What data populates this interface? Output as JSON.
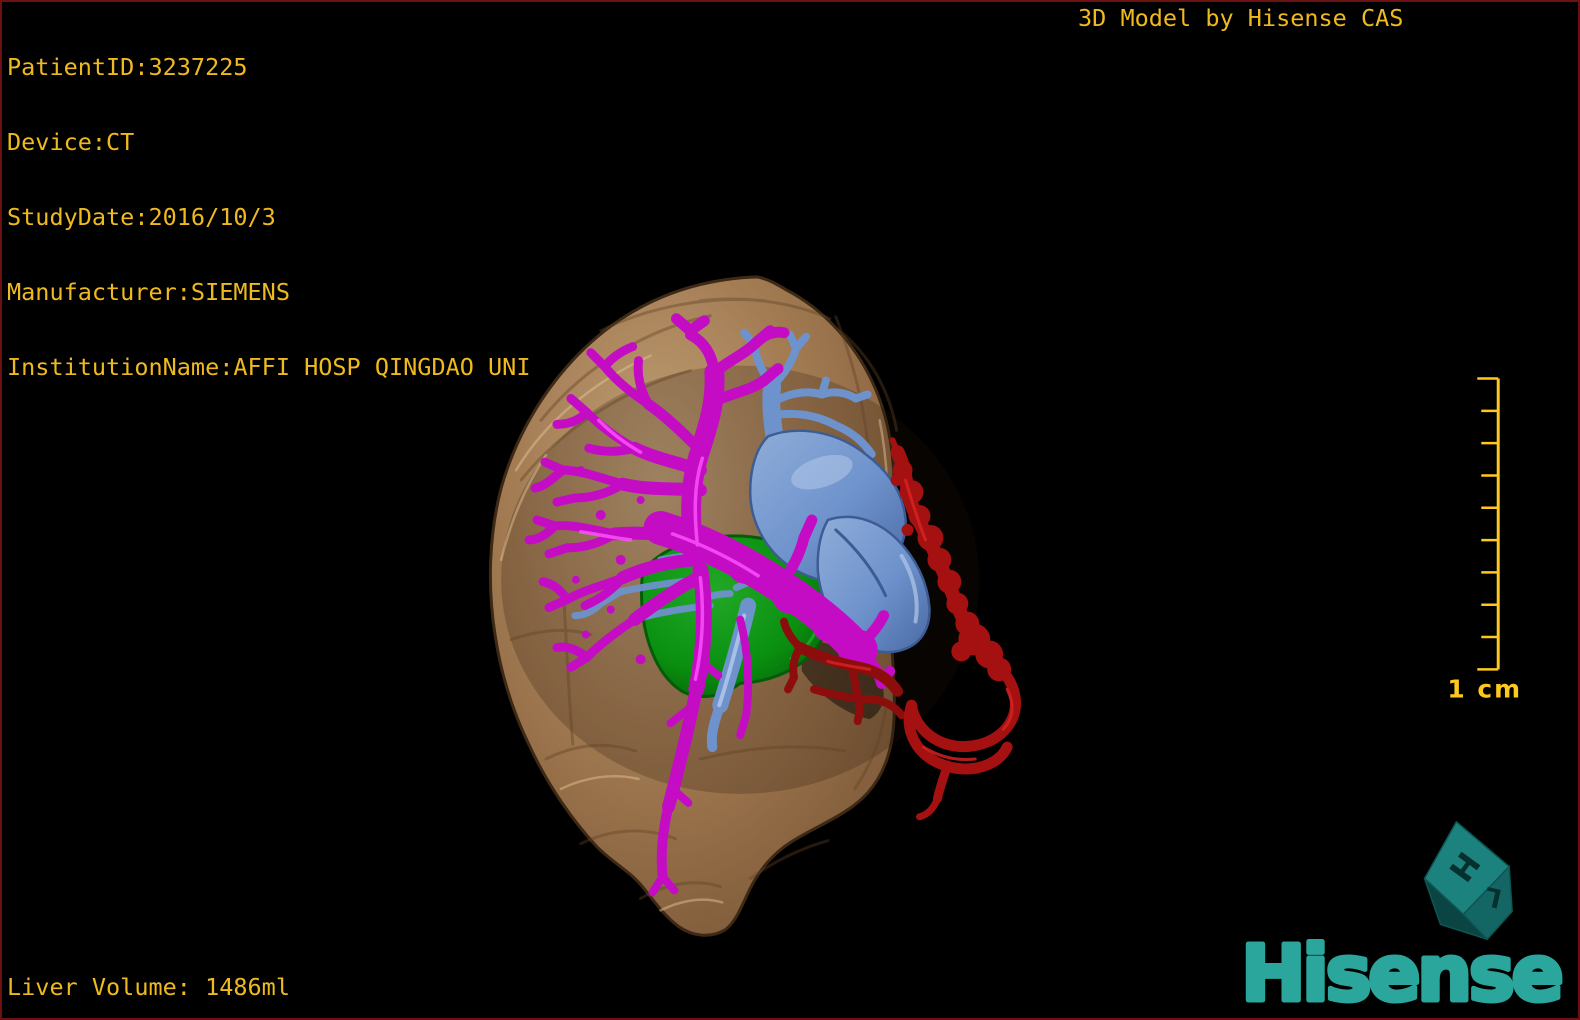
{
  "overlay": {
    "patient": {
      "lines": [
        "PatientID:3237225",
        "Device:CT",
        "StudyDate:2016/10/3",
        "Manufacturer:SIEMENS",
        "InstitutionName:AFFI HOSP QINGDAO UNI"
      ]
    },
    "title": "3D Model by Hisense CAS",
    "liver_volume": "Liver Volume: 1486ml"
  },
  "scale_bar": {
    "label": "1 cm",
    "tick_count": 10,
    "interval": "1 cm per division"
  },
  "branding": {
    "wordmark": "Hisense",
    "cube_letters": {
      "top": "H",
      "right": "L"
    }
  },
  "model": {
    "structures": [
      {
        "name": "liver-surface",
        "color": "#a87f55"
      },
      {
        "name": "portal-vein-tree",
        "color": "#c50cc5"
      },
      {
        "name": "hepatic-vein",
        "color": "#6e92cc"
      },
      {
        "name": "tumor",
        "color": "#0a9010"
      },
      {
        "name": "hepatic-artery",
        "color": "#a51111"
      }
    ]
  },
  "colors": {
    "overlay_text": "#efba1f",
    "scale_bar": "#ffc81e",
    "brand_teal": "#2ba69c",
    "frame_border": "#6b1111",
    "background": "#000000",
    "liver": "#a87f55",
    "portal_vein": "#c50cc5",
    "hepatic_vein": "#6e92cc",
    "tumor": "#0a9010",
    "artery": "#a51111"
  }
}
